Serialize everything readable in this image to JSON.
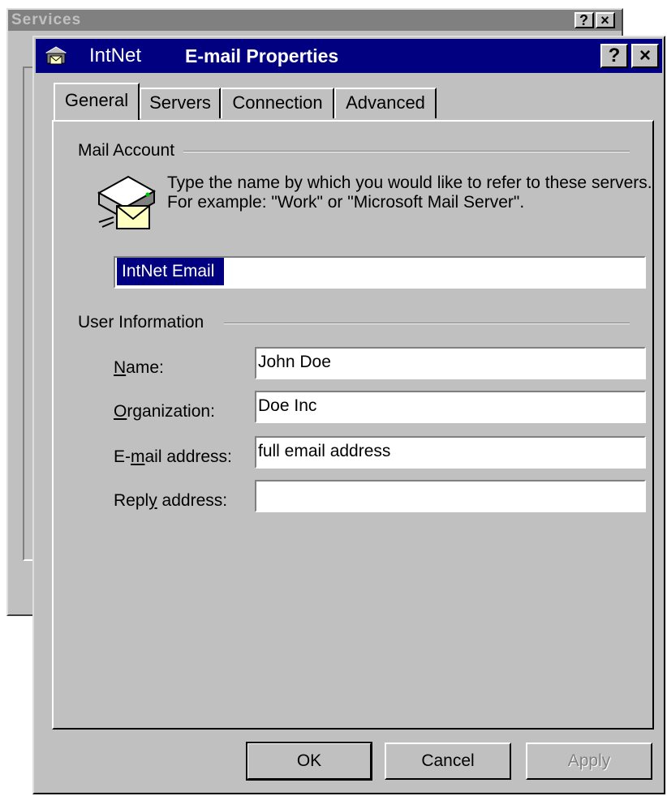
{
  "background_window": {
    "title": "Services",
    "help_label": "?",
    "close_label": "×"
  },
  "dialog": {
    "app_name": "IntNet",
    "title": "E-mail Properties",
    "help_label": "?",
    "close_label": "×"
  },
  "tabs": [
    {
      "label": "General",
      "active": true
    },
    {
      "label": "Servers",
      "active": false
    },
    {
      "label": "Connection",
      "active": false
    },
    {
      "label": "Advanced",
      "active": false
    }
  ],
  "mail_account": {
    "group_label": "Mail Account",
    "description": "Type the name by which you would like to refer to these servers.  For example: \"Work\" or \"Microsoft Mail Server\".",
    "account_name_value": "IntNet Email"
  },
  "user_information": {
    "group_label": "User Information",
    "name_label": "Name:",
    "name_value": "John Doe",
    "organization_label": "Organization:",
    "organization_value": "Doe Inc",
    "email_label": "E-mail address:",
    "email_value": "full email address",
    "reply_label": "Reply address:",
    "reply_value": ""
  },
  "buttons": {
    "ok": "OK",
    "cancel": "Cancel",
    "apply": "Apply"
  },
  "colors": {
    "titlebar": "#000080",
    "face": "#c0c0c0",
    "selection": "#000080"
  },
  "icons": [
    "mail-server-icon",
    "help-icon",
    "close-icon"
  ]
}
